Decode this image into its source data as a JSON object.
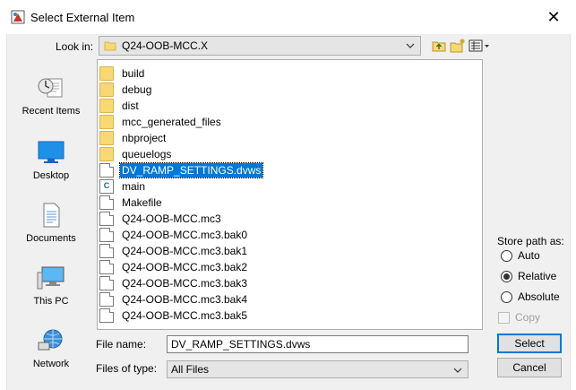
{
  "window": {
    "title": "Select External Item",
    "close_glyph": "✕"
  },
  "look_in": {
    "label": "Look in:",
    "value": "Q24-OOB-MCC.X",
    "icon": "folder-icon"
  },
  "toolbar": [
    {
      "name": "up-folder-icon"
    },
    {
      "name": "new-folder-icon"
    },
    {
      "name": "view-menu-icon"
    }
  ],
  "places": [
    {
      "label": "Recent Items",
      "icon": "recent-items-icon"
    },
    {
      "label": "Desktop",
      "icon": "desktop-icon"
    },
    {
      "label": "Documents",
      "icon": "documents-icon"
    },
    {
      "label": "This PC",
      "icon": "this-pc-icon"
    },
    {
      "label": "Network",
      "icon": "network-icon"
    }
  ],
  "files": [
    {
      "name": "build",
      "type": "folder"
    },
    {
      "name": "debug",
      "type": "folder"
    },
    {
      "name": "dist",
      "type": "folder"
    },
    {
      "name": "mcc_generated_files",
      "type": "folder"
    },
    {
      "name": "nbproject",
      "type": "folder"
    },
    {
      "name": "queuelogs",
      "type": "folder"
    },
    {
      "name": "DV_RAMP_SETTINGS.dvws",
      "type": "file",
      "selected": true
    },
    {
      "name": "main",
      "type": "c-file"
    },
    {
      "name": "Makefile",
      "type": "file"
    },
    {
      "name": "Q24-OOB-MCC.mc3",
      "type": "file"
    },
    {
      "name": "Q24-OOB-MCC.mc3.bak0",
      "type": "file"
    },
    {
      "name": "Q24-OOB-MCC.mc3.bak1",
      "type": "file"
    },
    {
      "name": "Q24-OOB-MCC.mc3.bak2",
      "type": "file"
    },
    {
      "name": "Q24-OOB-MCC.mc3.bak3",
      "type": "file"
    },
    {
      "name": "Q24-OOB-MCC.mc3.bak4",
      "type": "file"
    },
    {
      "name": "Q24-OOB-MCC.mc3.bak5",
      "type": "file"
    }
  ],
  "store_path": {
    "label": "Store path as:",
    "options": [
      "Auto",
      "Relative",
      "Absolute"
    ],
    "selected": "Relative",
    "copy_label": "Copy",
    "copy_checked": false,
    "copy_enabled": false
  },
  "file_name": {
    "label": "File name:",
    "value": "DV_RAMP_SETTINGS.dvws"
  },
  "files_of_type": {
    "label": "Files of type:",
    "value": "All Files"
  },
  "buttons": {
    "select": "Select",
    "cancel": "Cancel"
  },
  "colors": {
    "selection": "#0078d7",
    "folder": "#f8d775",
    "dialog_bg": "#f0f0f0"
  }
}
